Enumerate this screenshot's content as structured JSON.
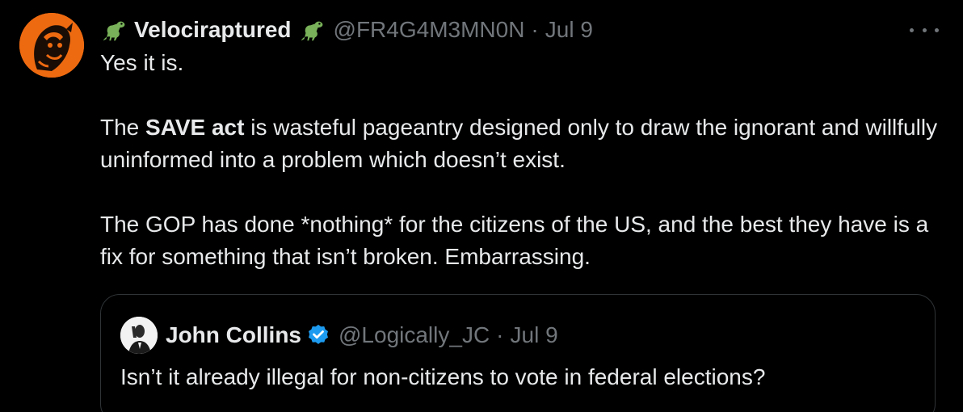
{
  "tweet": {
    "display_name": "Velociraptured",
    "handle": "@FR4G4M3MN0N",
    "separator": "·",
    "date": "Jul 9",
    "name_emoji": "t-rex-emoji",
    "paragraphs": {
      "p1": "Yes it is.",
      "p2_prefix": "The ",
      "p2_bold": "SAVE act",
      "p2_suffix": " is wasteful pageantry designed only to draw the ignorant and willfully uninformed into a problem which doesn’t exist.",
      "p3": "The GOP has done *nothing* for the citizens of the US, and the best they have is a fix for something that isn’t broken. Embarrassing."
    }
  },
  "quoted_tweet": {
    "display_name": "John Collins",
    "handle": "@Logically_JC",
    "separator": "·",
    "date": "Jul 9",
    "text": "Isn’t it already illegal for non-citizens to vote in federal elections?"
  },
  "colors": {
    "background": "#000000",
    "text_primary": "#e7e9ea",
    "text_secondary": "#71767b",
    "border": "#2f3336",
    "verified_blue": "#1d9bf0",
    "avatar_orange": "#ee6a10",
    "dino_green": "#78b159"
  },
  "icons": {
    "more": "more-horizontal-icon",
    "verified": "verified-badge-icon"
  }
}
